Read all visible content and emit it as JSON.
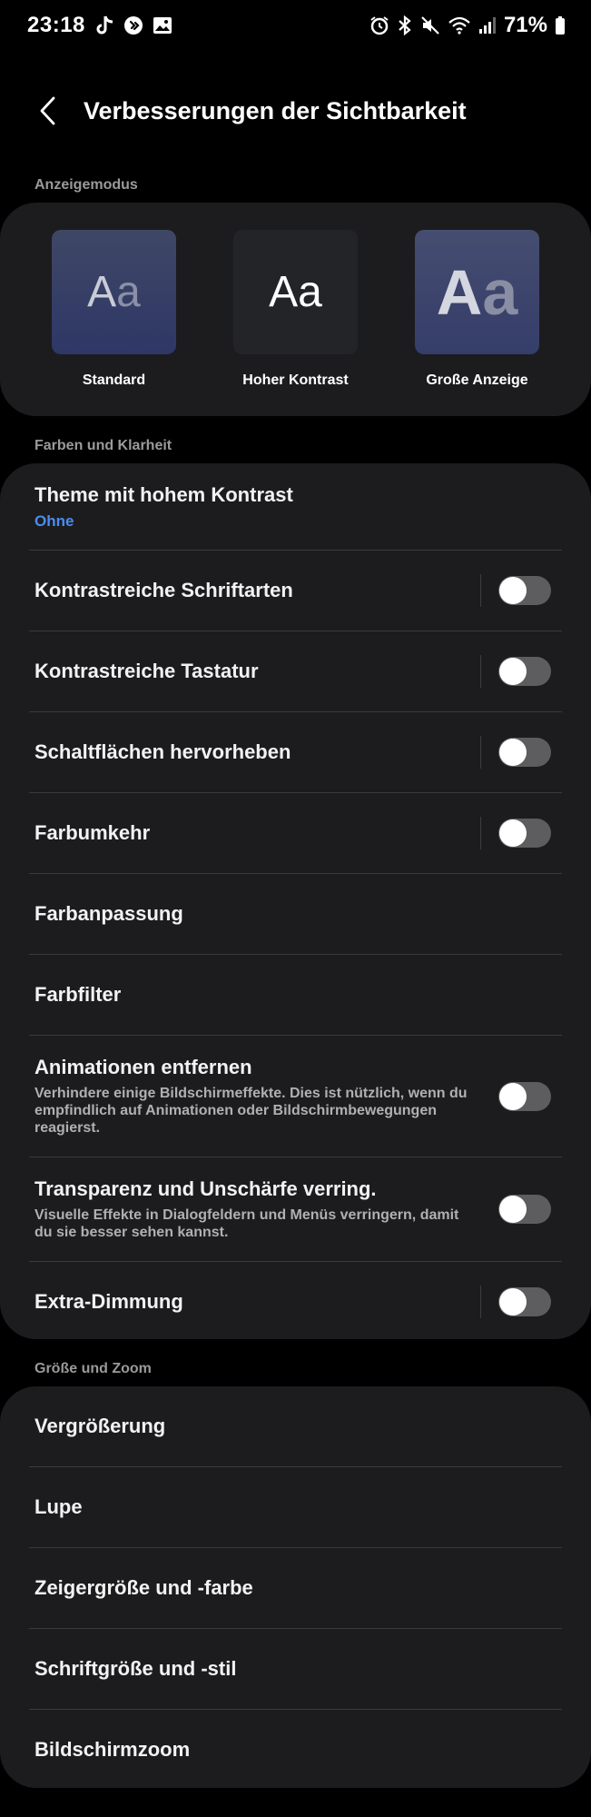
{
  "status_bar": {
    "time": "23:18",
    "battery": "71%",
    "left_icons": [
      "tiktok-icon",
      "shazam-icon",
      "gallery-icon"
    ],
    "right_icons": [
      "alarm-icon",
      "bluetooth-icon",
      "mute-icon",
      "wifi-icon",
      "signal-icon",
      "battery-icon"
    ]
  },
  "header": {
    "title": "Verbesserungen der Sichtbarkeit"
  },
  "display_mode": {
    "section_label": "Anzeigemodus",
    "modes": [
      {
        "preview": "Aa",
        "label": "Standard"
      },
      {
        "preview": "Aa",
        "label": "Hoher Kontrast"
      },
      {
        "preview": "Aa",
        "label": "Große Anzeige"
      }
    ]
  },
  "colors": {
    "section_label": "Farben und Klarheit",
    "items": [
      {
        "title": "Theme mit hohem Kontrast",
        "subtitle": "Ohne"
      },
      {
        "title": "Kontrastreiche Schriftarten",
        "toggle": false
      },
      {
        "title": "Kontrastreiche Tastatur",
        "toggle": false
      },
      {
        "title": "Schaltflächen hervorheben",
        "toggle": false
      },
      {
        "title": "Farbumkehr",
        "toggle": false
      },
      {
        "title": "Farbanpassung"
      },
      {
        "title": "Farbfilter"
      },
      {
        "title": "Animationen entfernen",
        "description": "Verhindere einige Bildschirmeffekte. Dies ist nützlich, wenn du empfindlich auf Animationen oder Bildschirmbewegungen reagierst.",
        "toggle": false
      },
      {
        "title": "Transparenz und Unschärfe verring.",
        "description": "Visuelle Effekte in Dialogfeldern und Menüs verringern, damit du sie besser sehen kannst.",
        "toggle": false
      },
      {
        "title": "Extra-Dimmung",
        "toggle": false
      }
    ]
  },
  "size_zoom": {
    "section_label": "Größe und Zoom",
    "items": [
      {
        "title": "Vergrößerung"
      },
      {
        "title": "Lupe"
      },
      {
        "title": "Zeigergröße und -farbe"
      },
      {
        "title": "Schriftgröße und -stil"
      },
      {
        "title": "Bildschirmzoom"
      }
    ]
  },
  "theme": {
    "background": "#000000",
    "card": "#1c1c1e",
    "accent": "#4a8df0",
    "toggle_off": "#5d5d60"
  }
}
